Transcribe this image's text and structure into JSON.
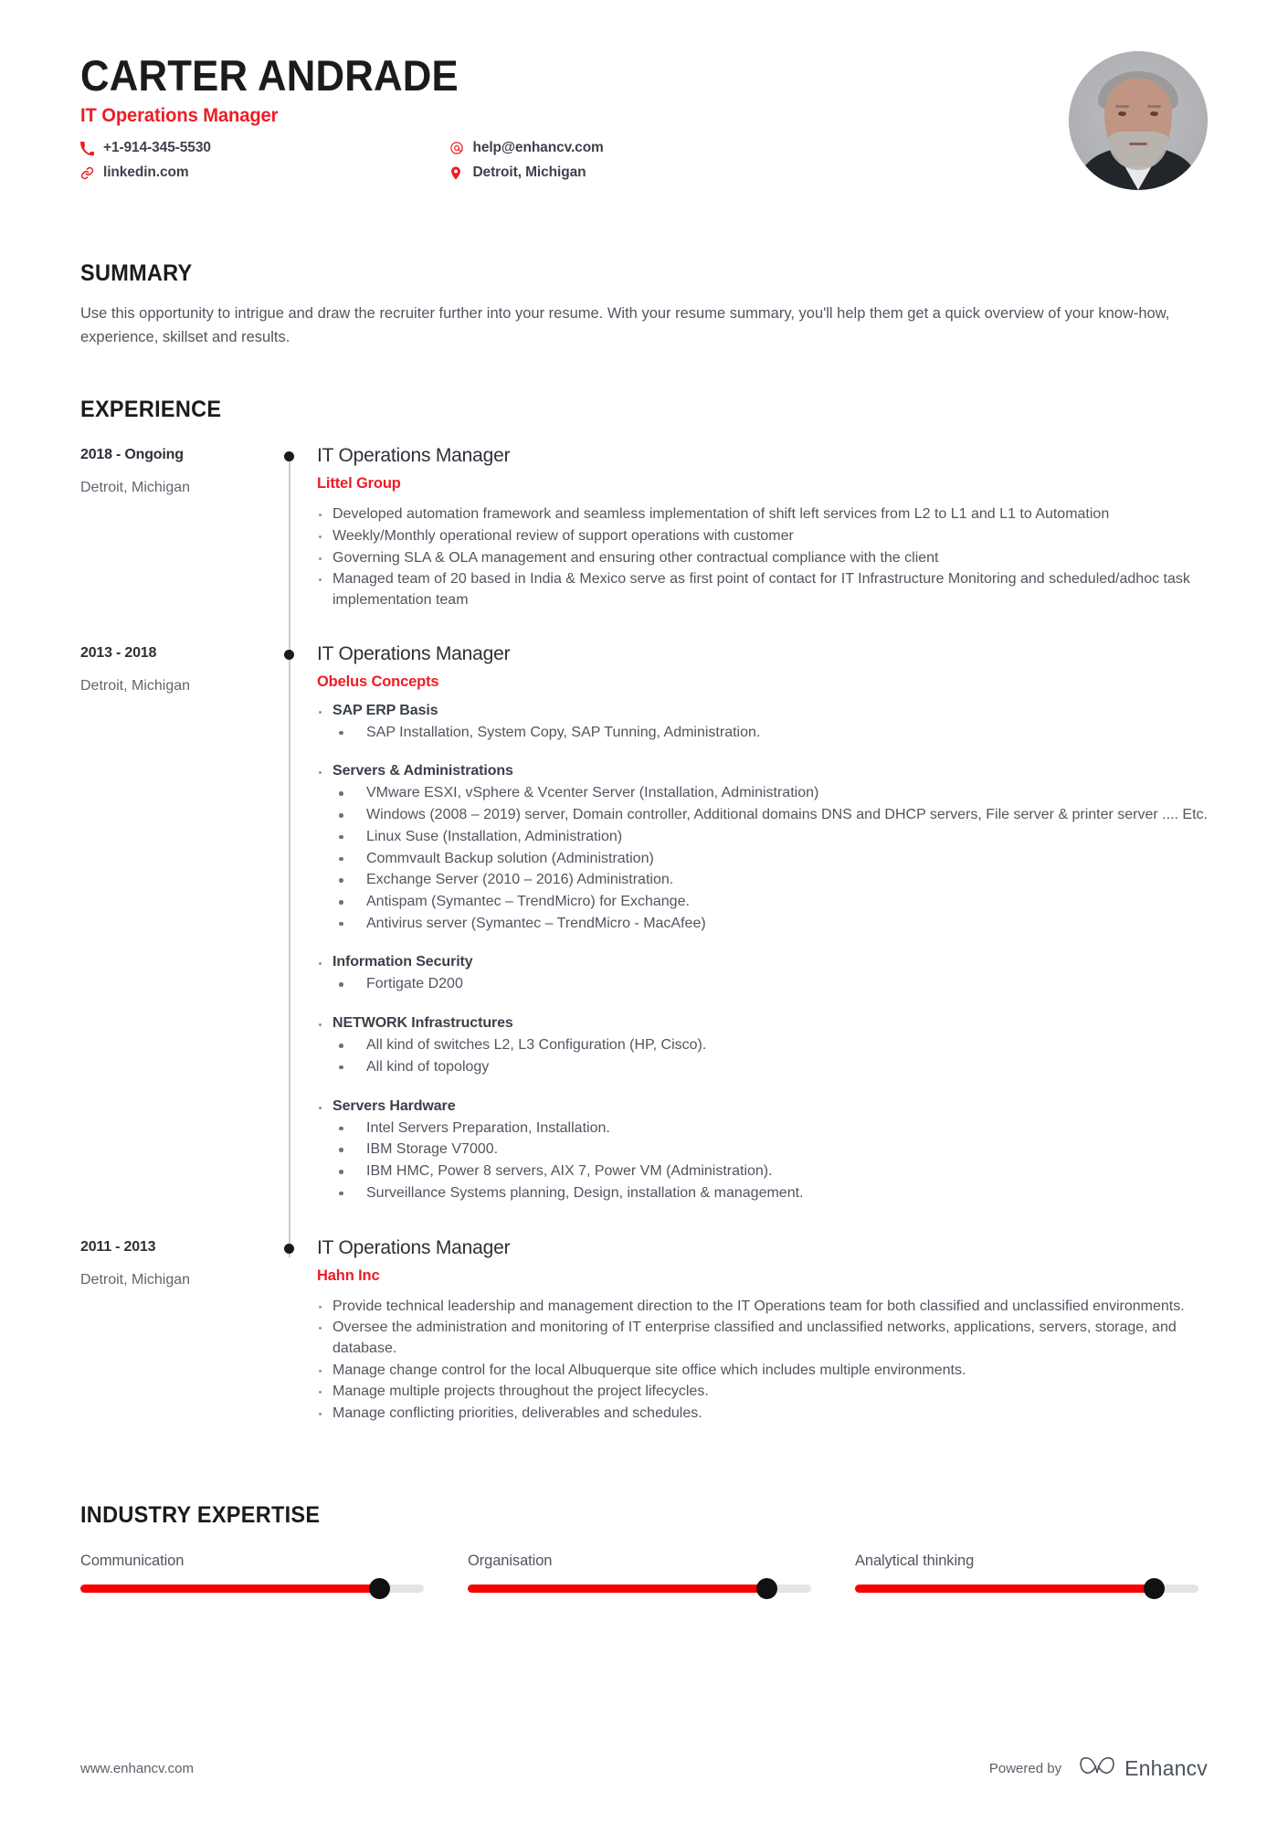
{
  "header": {
    "name": "CARTER ANDRADE",
    "job_title": "IT Operations Manager",
    "contacts_left": [
      {
        "icon": "phone-icon",
        "value": "+1-914-345-5530"
      },
      {
        "icon": "link-icon",
        "value": "linkedin.com"
      }
    ],
    "contacts_right": [
      {
        "icon": "email-icon",
        "value": "help@enhancv.com"
      },
      {
        "icon": "location-pin-icon",
        "value": "Detroit, Michigan"
      }
    ],
    "avatar_alt": "profile-photo"
  },
  "summary": {
    "title": "SUMMARY",
    "text": "Use this opportunity to intrigue and draw the recruiter further into your resume. With your resume summary, you'll help them get a quick overview of your know-how, experience, skillset and results."
  },
  "experience": {
    "title": "EXPERIENCE",
    "items": [
      {
        "dates": "2018 - Ongoing",
        "location": "Detroit, Michigan",
        "role": "IT Operations Manager",
        "company": "Littel Group",
        "bullets": [
          "Developed automation framework and seamless implementation of shift left services from L2 to L1 and L1 to Automation",
          "Weekly/Monthly operational review of support operations with customer",
          "Governing SLA & OLA management and ensuring other contractual compliance with the client",
          "Managed team of 20 based in India & Mexico serve as first point of contact for IT Infrastructure Monitoring and scheduled/adhoc task implementation team"
        ],
        "groups": []
      },
      {
        "dates": "2013 - 2018",
        "location": "Detroit, Michigan",
        "role": "IT Operations Manager",
        "company": "Obelus Concepts",
        "bullets": [],
        "groups": [
          {
            "heading": "SAP ERP Basis",
            "items": [
              "SAP Installation, System Copy, SAP Tunning, Administration."
            ]
          },
          {
            "heading": "Servers & Administrations",
            "items": [
              "VMware ESXI, vSphere & Vcenter Server (Installation, Administration)",
              "Windows (2008 – 2019) server, Domain controller, Additional domains DNS and DHCP servers, File server & printer server .... Etc.",
              "Linux Suse (Installation, Administration)",
              "Commvault Backup solution (Administration)",
              "Exchange Server (2010 – 2016) Administration.",
              "Antispam (Symantec – TrendMicro) for Exchange.",
              "Antivirus server (Symantec – TrendMicro - MacAfee)"
            ]
          },
          {
            "heading": "Information Security",
            "items": [
              "Fortigate D200"
            ]
          },
          {
            "heading": "NETWORK Infrastructures",
            "items": [
              "All kind of switches L2, L3 Configuration (HP, Cisco).",
              "All kind of topology"
            ]
          },
          {
            "heading": "Servers Hardware",
            "items": [
              "Intel Servers Preparation, Installation.",
              "IBM Storage V7000.",
              "IBM HMC, Power 8 servers, AIX 7, Power VM (Administration).",
              "Surveillance Systems planning, Design, installation & management."
            ]
          }
        ]
      },
      {
        "dates": "2011 - 2013",
        "location": "Detroit, Michigan",
        "role": "IT Operations Manager",
        "company": "Hahn Inc",
        "bullets": [
          "Provide technical leadership and management direction to the IT Operations team for both classified and unclassified environments.",
          "Oversee the administration and monitoring of IT enterprise classified and unclassified networks, applications, servers, storage, and database.",
          "Manage change control for the local Albuquerque site office which includes multiple environments.",
          "Manage multiple projects throughout the project lifecycles.",
          "Manage conflicting priorities, deliverables and schedules."
        ],
        "groups": []
      }
    ]
  },
  "expertise": {
    "title": "INDUSTRY EXPERTISE",
    "skills": [
      {
        "label": "Communication",
        "percent": 87
      },
      {
        "label": "Organisation",
        "percent": 87
      },
      {
        "label": "Analytical thinking",
        "percent": 87
      }
    ]
  },
  "footer": {
    "url": "www.enhancv.com",
    "powered_by": "Powered by",
    "brand_name": "Enhancv"
  },
  "colors": {
    "accent": "#ee1c25",
    "slider_fill": "#fb0000",
    "slider_track": "#e4e4e4",
    "heading": "#1b1b1b",
    "body_text": "#50565f"
  }
}
